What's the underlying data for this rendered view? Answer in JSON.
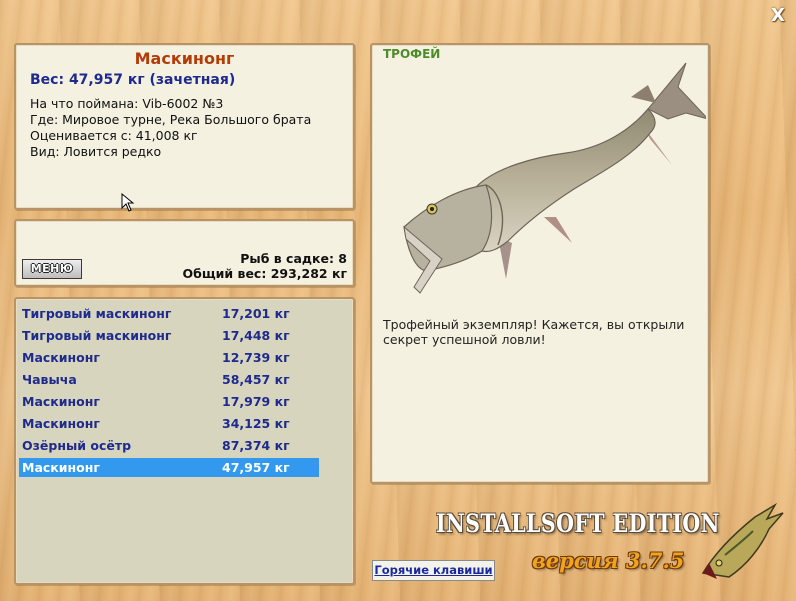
{
  "window": {
    "close_label": "X"
  },
  "catch": {
    "name": "Маскинонг",
    "weight_line": "Вес: 47,957 кг (зачетная)",
    "bait_line": "На что поймана: Vib-6002 №3",
    "where_line": "Где: Мировое турне, Река Большого брата",
    "rated_line": "Оценивается с: 41,008 кг",
    "kind_line": "Вид: Ловится редко"
  },
  "keepnet": {
    "menu_label": "МЕНЮ",
    "count_line": "Рыб в садке: 8",
    "total_line": "Общий вес: 293,282 кг"
  },
  "fish_list": [
    {
      "name": "Тигровый маскинонг",
      "weight": "17,201 кг",
      "selected": false
    },
    {
      "name": "Тигровый маскинонг",
      "weight": "17,448 кг",
      "selected": false
    },
    {
      "name": "Маскинонг",
      "weight": "12,739 кг",
      "selected": false
    },
    {
      "name": "Чавыча",
      "weight": "58,457 кг",
      "selected": false
    },
    {
      "name": "Маскинонг",
      "weight": "17,979 кг",
      "selected": false
    },
    {
      "name": "Маскинонг",
      "weight": "34,125 кг",
      "selected": false
    },
    {
      "name": "Озёрный осётр",
      "weight": "87,374 кг",
      "selected": false
    },
    {
      "name": "Маскинонг",
      "weight": "47,957 кг",
      "selected": true
    }
  ],
  "trophy": {
    "label": "ТРОФЕЙ",
    "description": "Трофейный экземпляр! Кажется, вы открыли секрет успешной ловли!",
    "image_icon": "muskellunge-fish-image"
  },
  "branding": {
    "edition": "INSTALLSOFT EDITION",
    "version": "версия 3.7.5",
    "logo_icon": "pike-logo-icon"
  },
  "hotkeys_label": "Горячие клавиши",
  "colors": {
    "fish_name": "#b43c0a",
    "info_blue": "#1e2a8c",
    "trophy_green": "#4f8a2b",
    "selection": "#3399ee",
    "version_orange": "#f3a21b"
  }
}
